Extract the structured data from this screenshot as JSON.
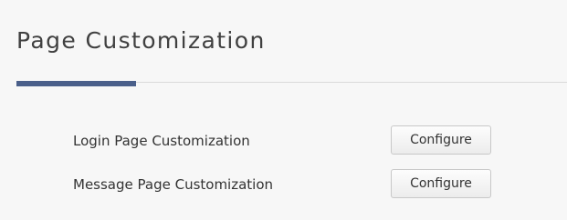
{
  "header": {
    "title": "Page Customization"
  },
  "rows": [
    {
      "label": "Login Page Customization",
      "button_label": "Configure"
    },
    {
      "label": "Message Page Customization",
      "button_label": "Configure"
    }
  ],
  "colors": {
    "accent": "#4a5f8a",
    "background": "#f7f7f7",
    "text": "#333333"
  }
}
